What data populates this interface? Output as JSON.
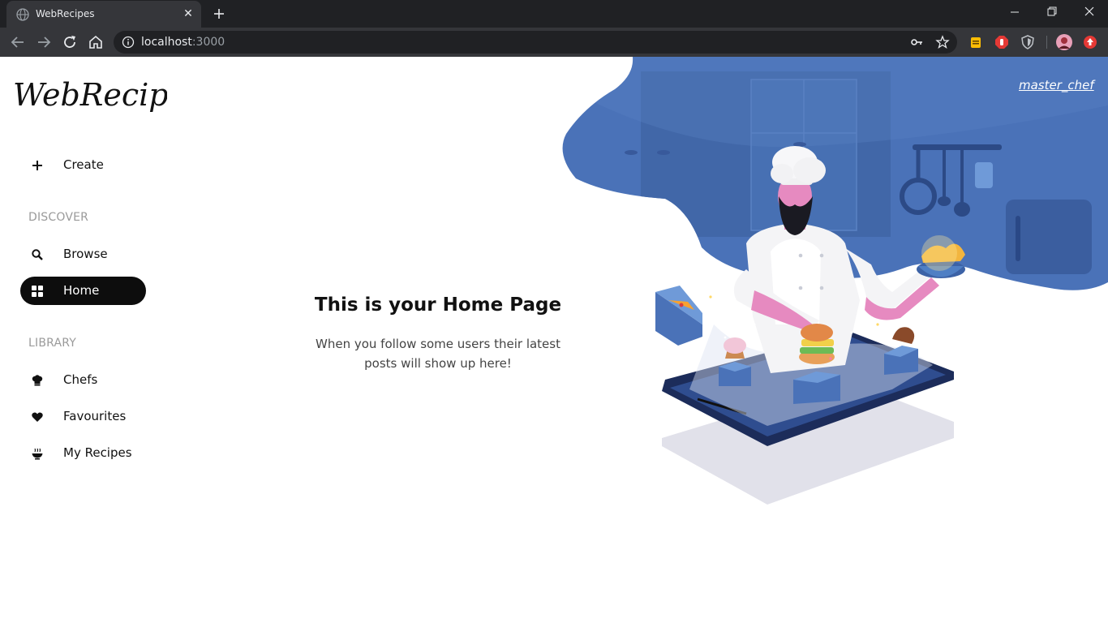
{
  "browser": {
    "tab_title": "WebRecipes",
    "tab_close": "✕",
    "url_host": "localhost",
    "url_port": ":3000"
  },
  "app": {
    "logo_text": "WebRecipes",
    "user": "master_chef"
  },
  "sidebar": {
    "create": "Create",
    "discover_heading": "DISCOVER",
    "discover": [
      {
        "label": "Browse",
        "icon": "search-icon"
      },
      {
        "label": "Home",
        "icon": "grid-icon",
        "active": true
      }
    ],
    "library_heading": "LIBRARY",
    "library": [
      {
        "label": "Chefs",
        "icon": "chef-hat-icon"
      },
      {
        "label": "Favourites",
        "icon": "heart-icon"
      },
      {
        "label": "My Recipes",
        "icon": "bowl-icon"
      }
    ]
  },
  "main": {
    "title": "This is your Home Page",
    "subtitle": "When you follow some users their latest posts will show up here!"
  },
  "colors": {
    "accent": "#0d0d0d",
    "hero_blue": "#4a72b8",
    "chrome_dark": "#202124",
    "chrome_toolbar": "#35363a"
  }
}
